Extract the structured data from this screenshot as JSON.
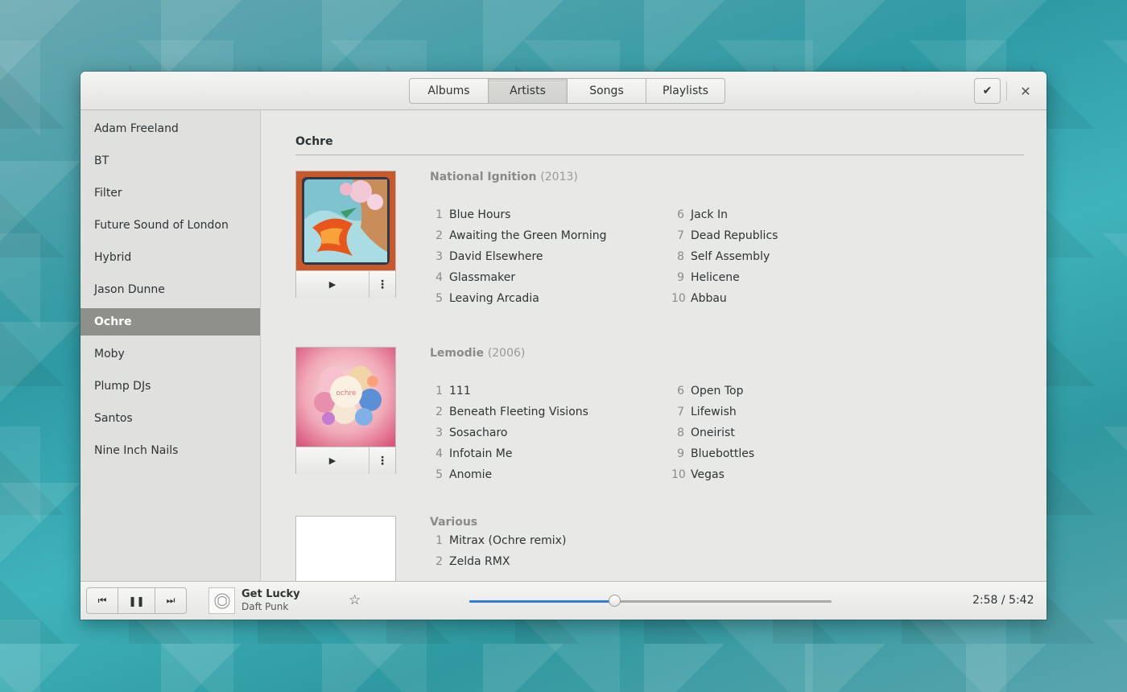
{
  "header": {
    "tabs": [
      {
        "label": "Albums",
        "active": false
      },
      {
        "label": "Artists",
        "active": true
      },
      {
        "label": "Songs",
        "active": false
      },
      {
        "label": "Playlists",
        "active": false
      }
    ],
    "select_icon": "check-icon",
    "close_icon": "close-icon"
  },
  "sidebar": {
    "artists": [
      "Adam Freeland",
      "BT",
      "Filter",
      "Future Sound of London",
      "Hybrid",
      "Jason Dunne",
      "Ochre",
      "Moby",
      "Plump DJs",
      "Santos",
      "Nine Inch Nails"
    ],
    "selected": "Ochre"
  },
  "main": {
    "artist": "Ochre",
    "albums": [
      {
        "title": "National Ignition",
        "year": "(2013)",
        "cover": "national-ignition-art",
        "tracks": [
          {
            "n": "1",
            "t": "Blue Hours"
          },
          {
            "n": "2",
            "t": "Awaiting the Green Morning"
          },
          {
            "n": "3",
            "t": "David Elsewhere"
          },
          {
            "n": "4",
            "t": "Glassmaker"
          },
          {
            "n": "5",
            "t": "Leaving Arcadia"
          },
          {
            "n": "6",
            "t": "Jack In"
          },
          {
            "n": "7",
            "t": "Dead Republics"
          },
          {
            "n": "8",
            "t": "Self Assembly"
          },
          {
            "n": "9",
            "t": "Helicene"
          },
          {
            "n": "10",
            "t": "Abbau"
          }
        ]
      },
      {
        "title": "Lemodie",
        "year": "(2006)",
        "cover": "lemodie-art",
        "tracks": [
          {
            "n": "1",
            "t": "111"
          },
          {
            "n": "2",
            "t": "Beneath Fleeting Visions"
          },
          {
            "n": "3",
            "t": "Sosacharo"
          },
          {
            "n": "4",
            "t": "Infotain Me"
          },
          {
            "n": "5",
            "t": "Anomie"
          },
          {
            "n": "6",
            "t": "Open Top"
          },
          {
            "n": "7",
            "t": "Lifewish"
          },
          {
            "n": "8",
            "t": "Oneirist"
          },
          {
            "n": "9",
            "t": "Bluebottles"
          },
          {
            "n": "10",
            "t": "Vegas"
          }
        ]
      },
      {
        "title": "Various",
        "year": "",
        "cover": "music-note-placeholder",
        "tracks": [
          {
            "n": "1",
            "t": "Mitrax (Ochre remix)"
          },
          {
            "n": "2",
            "t": "Zelda RMX"
          }
        ]
      }
    ]
  },
  "player": {
    "title": "Get Lucky",
    "artist": "Daft Punk",
    "time": "2:58 / 5:42",
    "progress": 0.4,
    "accent": "#3a7bd5",
    "icons": [
      "previous-icon",
      "pause-icon",
      "next-icon",
      "star-icon"
    ]
  }
}
